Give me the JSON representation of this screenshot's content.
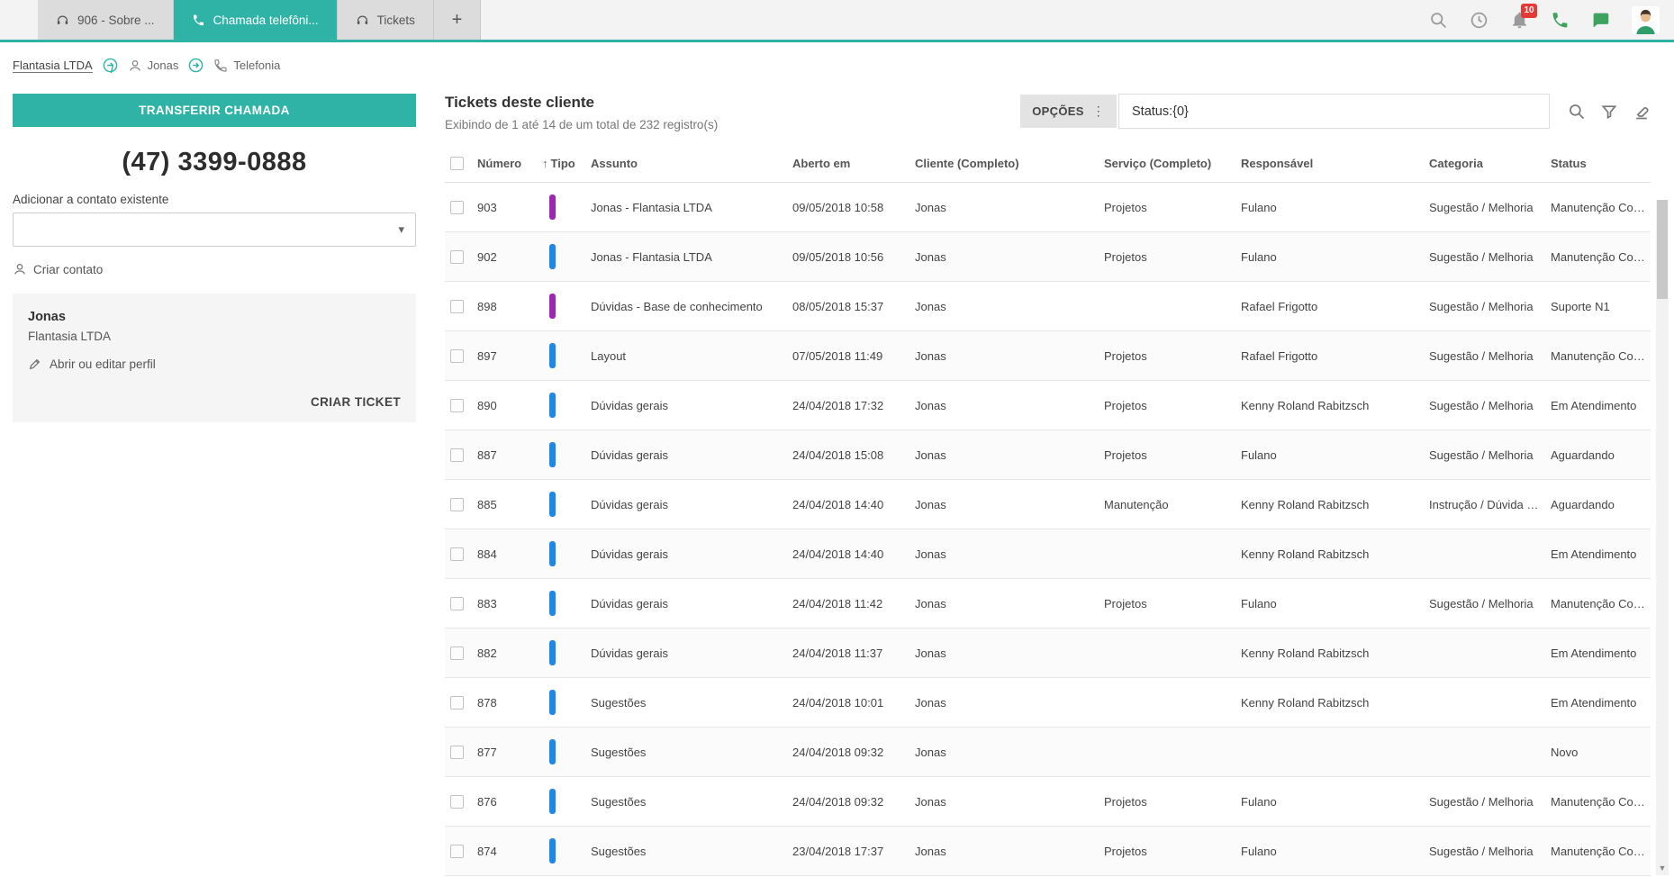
{
  "colors": {
    "accent": "#2fb3a6",
    "type_blue": "#1e88e5",
    "type_purple": "#9c27b0",
    "badge_red": "#e53935"
  },
  "icons": {
    "caret_down": "▾",
    "sort_asc": "↑",
    "dots_vertical": "⋮",
    "add_tab": "+",
    "scroll_down": "▼"
  },
  "topbar": {
    "tabs": [
      {
        "label": "906 - Sobre ...",
        "active": false
      },
      {
        "label": "Chamada telefôni...",
        "active": true
      },
      {
        "label": "Tickets",
        "active": false
      }
    ],
    "notification_count": "10"
  },
  "breadcrumb": {
    "company": "Flantasia LTDA",
    "contact": "Jonas",
    "section": "Telefonia"
  },
  "sidebar": {
    "transfer_button": "TRANSFERIR CHAMADA",
    "phone_number": "(47) 3399-0888",
    "add_contact_label": "Adicionar a contato existente",
    "create_contact_link": "Criar contato",
    "contact_card": {
      "name": "Jonas",
      "company": "Flantasia LTDA",
      "edit_profile_link": "Abrir ou editar perfil",
      "create_ticket_button": "CRIAR TICKET"
    }
  },
  "main": {
    "title": "Tickets deste cliente",
    "subtitle": "Exibindo de 1 até 14 de um total de 232 registro(s)",
    "options_button": "OPÇÕES",
    "search_value": "Status:{0}"
  },
  "table": {
    "columns": [
      "Número",
      "Tipo",
      "Assunto",
      "Aberto em",
      "Cliente (Completo)",
      "Serviço (Completo)",
      "Responsável",
      "Categoria",
      "Status"
    ],
    "rows": [
      {
        "numero": "903",
        "tipo_color": "#9c27b0",
        "assunto": "Jonas - Flantasia LTDA",
        "aberto_em": "09/05/2018 10:58",
        "cliente": "Jonas",
        "servico": "Projetos",
        "responsavel": "Fulano",
        "categoria": "Sugestão / Melhoria",
        "status": "Manutenção Corretiva"
      },
      {
        "numero": "902",
        "tipo_color": "#1e88e5",
        "assunto": "Jonas - Flantasia LTDA",
        "aberto_em": "09/05/2018 10:56",
        "cliente": "Jonas",
        "servico": "Projetos",
        "responsavel": "Fulano",
        "categoria": "Sugestão / Melhoria",
        "status": "Manutenção Corretiva"
      },
      {
        "numero": "898",
        "tipo_color": "#9c27b0",
        "assunto": "Dúvidas - Base de conhecimento",
        "aberto_em": "08/05/2018 15:37",
        "cliente": "Jonas",
        "servico": "",
        "responsavel": "Rafael Frigotto",
        "categoria": "Sugestão / Melhoria",
        "status": "Suporte N1"
      },
      {
        "numero": "897",
        "tipo_color": "#1e88e5",
        "assunto": "Layout",
        "aberto_em": "07/05/2018 11:49",
        "cliente": "Jonas",
        "servico": "Projetos",
        "responsavel": "Rafael Frigotto",
        "categoria": "Sugestão / Melhoria",
        "status": "Manutenção Corretiva"
      },
      {
        "numero": "890",
        "tipo_color": "#1e88e5",
        "assunto": "Dúvidas gerais",
        "aberto_em": "24/04/2018 17:32",
        "cliente": "Jonas",
        "servico": "Projetos",
        "responsavel": "Kenny Roland Rabitzsch",
        "categoria": "Sugestão / Melhoria",
        "status": "Em Atendimento"
      },
      {
        "numero": "887",
        "tipo_color": "#1e88e5",
        "assunto": "Dúvidas gerais",
        "aberto_em": "24/04/2018 15:08",
        "cliente": "Jonas",
        "servico": "Projetos",
        "responsavel": "Fulano",
        "categoria": "Sugestão / Melhoria",
        "status": "Aguardando"
      },
      {
        "numero": "885",
        "tipo_color": "#1e88e5",
        "assunto": "Dúvidas gerais",
        "aberto_em": "24/04/2018 14:40",
        "cliente": "Jonas",
        "servico": "Manutenção",
        "responsavel": "Kenny Roland Rabitzsch",
        "categoria": "Instrução / Dúvida / C...",
        "status": "Aguardando"
      },
      {
        "numero": "884",
        "tipo_color": "#1e88e5",
        "assunto": "Dúvidas gerais",
        "aberto_em": "24/04/2018 14:40",
        "cliente": "Jonas",
        "servico": "",
        "responsavel": "Kenny Roland Rabitzsch",
        "categoria": "",
        "status": "Em Atendimento"
      },
      {
        "numero": "883",
        "tipo_color": "#1e88e5",
        "assunto": "Dúvidas gerais",
        "aberto_em": "24/04/2018 11:42",
        "cliente": "Jonas",
        "servico": "Projetos",
        "responsavel": "Fulano",
        "categoria": "Sugestão / Melhoria",
        "status": "Manutenção Corretiva"
      },
      {
        "numero": "882",
        "tipo_color": "#1e88e5",
        "assunto": "Dúvidas gerais",
        "aberto_em": "24/04/2018 11:37",
        "cliente": "Jonas",
        "servico": "",
        "responsavel": "Kenny Roland Rabitzsch",
        "categoria": "",
        "status": "Em Atendimento"
      },
      {
        "numero": "878",
        "tipo_color": "#1e88e5",
        "assunto": "Sugestões",
        "aberto_em": "24/04/2018 10:01",
        "cliente": "Jonas",
        "servico": "",
        "responsavel": "Kenny Roland Rabitzsch",
        "categoria": "",
        "status": "Em Atendimento"
      },
      {
        "numero": "877",
        "tipo_color": "#1e88e5",
        "assunto": "Sugestões",
        "aberto_em": "24/04/2018 09:32",
        "cliente": "Jonas",
        "servico": "",
        "responsavel": "",
        "categoria": "",
        "status": "Novo"
      },
      {
        "numero": "876",
        "tipo_color": "#1e88e5",
        "assunto": "Sugestões",
        "aberto_em": "24/04/2018 09:32",
        "cliente": "Jonas",
        "servico": "Projetos",
        "responsavel": "Fulano",
        "categoria": "Sugestão / Melhoria",
        "status": "Manutenção Corretiva"
      },
      {
        "numero": "874",
        "tipo_color": "#1e88e5",
        "assunto": "Sugestões",
        "aberto_em": "23/04/2018 17:37",
        "cliente": "Jonas",
        "servico": "Projetos",
        "responsavel": "Fulano",
        "categoria": "Sugestão / Melhoria",
        "status": "Manutenção Corretiva"
      }
    ]
  }
}
